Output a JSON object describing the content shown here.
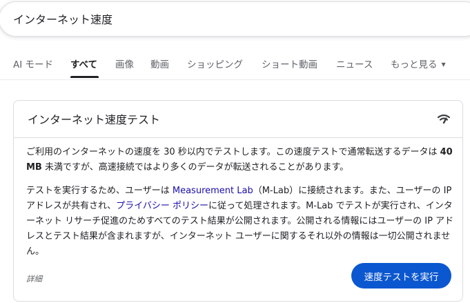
{
  "search": {
    "query": "インターネット速度"
  },
  "tabs": [
    {
      "label": "AI モード"
    },
    {
      "label": "すべて"
    },
    {
      "label": "画像"
    },
    {
      "label": "動画"
    },
    {
      "label": "ショッピング"
    },
    {
      "label": "ショート動画"
    },
    {
      "label": "ニュース"
    },
    {
      "label": "もっと見る"
    }
  ],
  "card": {
    "title": "インターネット速度テスト",
    "icon": "wifi-speed-icon",
    "para1": {
      "a": "ご利用のインターネットの速度を 30 秒以内でテストします。この速度テストで通常転送するデータは ",
      "bold": "40 MB",
      "b": " 未満ですが、高速接続ではより多くのデータが転送されることがあります。"
    },
    "para2": {
      "a": "テストを実行するため、ユーザーは ",
      "link1": "Measurement Lab",
      "b": "（M-Lab）に接続されます。また、ユーザーの IP アドレスが共有され、",
      "link2": "プライバシー ポリシー",
      "c": "に従って処理されます。M-Lab でテストが実行され、インターネット リサーチ促進のためすべてのテスト結果が公開されます。公開される情報にはユーザーの IP アドレスとテスト結果が含まれますが、インターネット ユーザーに関するそれ以外の情報は一切公開されません。"
    },
    "details_label": "詳細",
    "run_button_label": "速度テストを実行"
  },
  "colors": {
    "accent": "#0b57d0",
    "link": "#1a0dab"
  }
}
